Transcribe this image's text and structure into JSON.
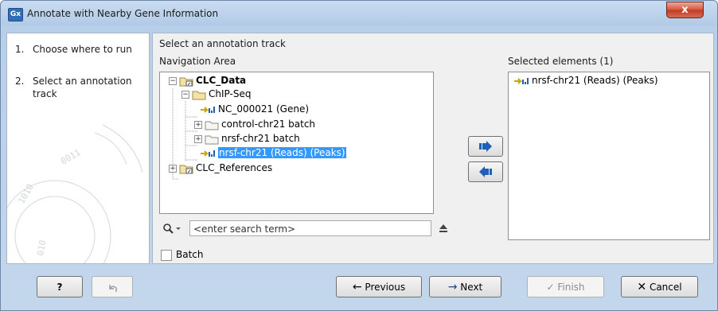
{
  "window": {
    "app_icon": "Gx",
    "title": "Annotate with Nearby Gene Information",
    "close_label": "x"
  },
  "steps": [
    {
      "num": "1.",
      "label": "Choose where to run"
    },
    {
      "num": "2.",
      "label": "Select an annotation",
      "label2": "track"
    }
  ],
  "main": {
    "heading": "Select an annotation track",
    "nav_label": "Navigation Area",
    "selected_label": "Selected elements (1)",
    "tree": [
      {
        "label": "CLC_Data"
      },
      {
        "label": "ChIP-Seq"
      },
      {
        "label": "NC_000021 (Gene)"
      },
      {
        "label": "control-chr21 batch"
      },
      {
        "label": "nrsf-chr21 batch"
      },
      {
        "label": "nrsf-chr21 (Reads) (Peaks)"
      },
      {
        "label": "CLC_References"
      }
    ],
    "search_placeholder": "<enter search term>",
    "selected_items": [
      "nrsf-chr21 (Reads) (Peaks)"
    ],
    "batch_label": "Batch"
  },
  "footer": {
    "help_label": "?",
    "previous_label": "Previous",
    "next_label": "Next",
    "finish_label": "Finish",
    "cancel_label": "Cancel"
  },
  "colors": {
    "selection": "#3399ff",
    "arrow_blue": "#1f5fb5",
    "track_yellow": "#e8d400"
  },
  "icons": [
    "app-icon",
    "close-icon",
    "folder-icon",
    "database-folder-icon",
    "track-icon",
    "search-icon",
    "eject-icon",
    "arrow-right-icon",
    "arrow-left-icon",
    "help-icon",
    "undo-icon",
    "previous-icon",
    "next-icon",
    "finish-check-icon",
    "cancel-x-icon"
  ]
}
